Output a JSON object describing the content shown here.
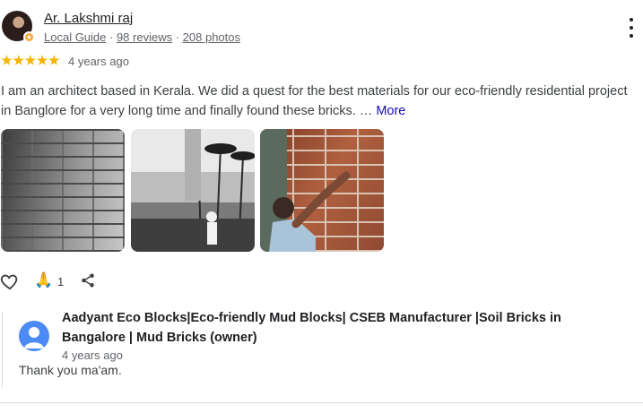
{
  "reviewer": {
    "name": "Ar. Lakshmi raj",
    "local_guide": "Local Guide",
    "separator": " · ",
    "reviews": "98 reviews",
    "photos": "208 photos"
  },
  "rating": {
    "stars": 5,
    "time": "4 years ago"
  },
  "review": {
    "text": "I am an architect based in Kerala. We did a quest for the best materials for our eco-friendly residential project in Banglore for a very long time and finally found these bricks. …",
    "more": "More"
  },
  "reactions": {
    "clap_emoji": "🙏",
    "clap_count": "1"
  },
  "owner_reply": {
    "name": "Aadyant Eco Blocks|Eco-friendly Mud Blocks| CSEB Manufacturer |Soil Bricks in Bangalore | Mud Bricks (owner)",
    "time": "4 years ago",
    "text": "Thank you ma'am."
  },
  "colors": {
    "star": "#f4b400",
    "link": "#1a0dab",
    "owner_avatar": "#4c8bf5"
  }
}
